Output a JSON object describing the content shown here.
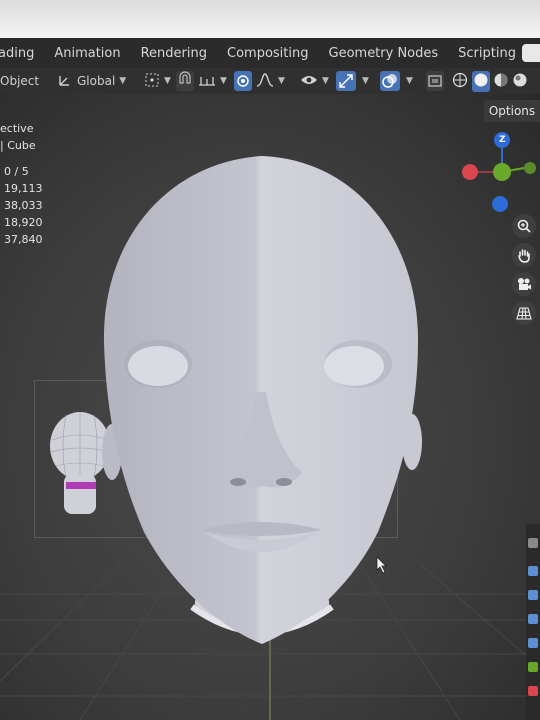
{
  "tabs": {
    "items": [
      "ading",
      "Animation",
      "Rendering",
      "Compositing",
      "Geometry Nodes",
      "Scripting"
    ],
    "add_label": "+"
  },
  "toolbar": {
    "mode_label": "Object",
    "orientation_label": "Global"
  },
  "viewport": {
    "options_label": "Options",
    "overlay_text": {
      "view_mode": "ective",
      "collection": "| Cube",
      "objects": "0 / 5",
      "vertices": "19,113",
      "edges": "38,033",
      "faces": "18,920",
      "triangles": "37,840"
    },
    "gizmo": {
      "z_label": "Z"
    }
  },
  "colors": {
    "accent_blue": "#4772b3",
    "axis_x": "#d9464f",
    "axis_y": "#6aa82a",
    "axis_z": "#2f6bd6",
    "mesh": "#c9cad4",
    "ring": "#b13cb5"
  }
}
